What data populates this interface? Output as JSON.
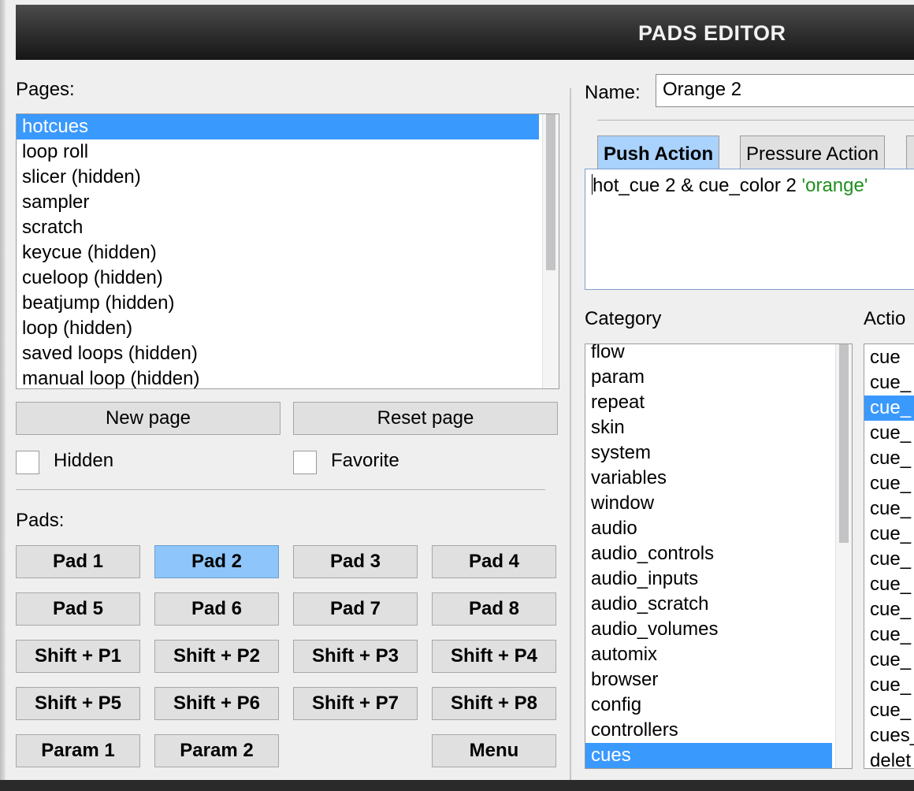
{
  "window": {
    "title": "PADS EDITOR"
  },
  "pages": {
    "label": "Pages:",
    "items": [
      "hotcues",
      "loop roll",
      "slicer (hidden)",
      "sampler",
      "scratch",
      "keycue (hidden)",
      "cueloop (hidden)",
      "beatjump (hidden)",
      "loop (hidden)",
      "saved loops (hidden)",
      "manual loop (hidden)"
    ],
    "selected": "hotcues",
    "new_page": "New page",
    "reset_page": "Reset page",
    "hidden_label": "Hidden",
    "favorite_label": "Favorite",
    "hidden_checked": false,
    "favorite_checked": false
  },
  "pads": {
    "label": "Pads:",
    "buttons": [
      "Pad 1",
      "Pad 2",
      "Pad 3",
      "Pad 4",
      "Pad 5",
      "Pad 6",
      "Pad 7",
      "Pad 8",
      "Shift + P1",
      "Shift + P2",
      "Shift + P3",
      "Shift + P4",
      "Shift + P5",
      "Shift + P6",
      "Shift + P7",
      "Shift + P8",
      "Param 1",
      "Param 2",
      "Menu"
    ],
    "active": "Pad 2"
  },
  "editor": {
    "name_label": "Name:",
    "name_value": "Orange 2",
    "tabs": [
      "Push Action",
      "Pressure Action"
    ],
    "active_tab": "Push Action",
    "script_plain": "hot_cue 2 & cue_color 2 ",
    "script_string": "'orange'"
  },
  "category": {
    "label": "Category",
    "items": [
      "flow",
      "param",
      "repeat",
      "skin",
      "system",
      "variables",
      "window",
      "audio",
      "audio_controls",
      "audio_inputs",
      "audio_scratch",
      "audio_volumes",
      "automix",
      "browser",
      "config",
      "controllers",
      "cues"
    ],
    "selected": "cues"
  },
  "actions": {
    "label": "Actio",
    "items": [
      "cue",
      "cue_",
      "cue_",
      "cue_",
      "cue_",
      "cue_",
      "cue_",
      "cue_",
      "cue_",
      "cue_",
      "cue_",
      "cue_",
      "cue_",
      "cue_",
      "cue_",
      "cues_",
      "delet"
    ],
    "selected_index": 2
  },
  "colors": {
    "selection": "#3a99fd",
    "active_pad": "#8ec6fb",
    "active_tab": "#a9d2fd",
    "string_literal": "#1f8f1f"
  }
}
